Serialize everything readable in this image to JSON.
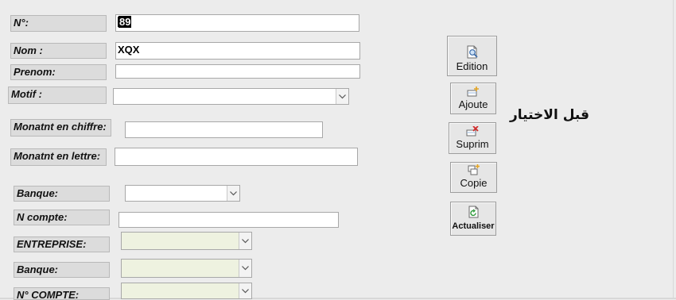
{
  "form": {
    "numero": {
      "label": "N°:",
      "value_selected": "89"
    },
    "nom": {
      "label": "Nom :",
      "value": "XQX"
    },
    "prenom": {
      "label": "Prenom:",
      "value": ""
    },
    "motif": {
      "label": "Motif :",
      "value": ""
    },
    "montant_chiffre": {
      "label": "Monatnt en chiffre:",
      "value": ""
    },
    "montant_lettre": {
      "label": "Monatnt en lettre:",
      "value": ""
    },
    "banque1": {
      "label": "Banque:",
      "value": ""
    },
    "n_compte": {
      "label": "N compte:",
      "value": ""
    },
    "entreprise": {
      "label": "ENTREPRISE:",
      "value": ""
    },
    "banque2": {
      "label": "Banque:",
      "value": ""
    },
    "n_compte2": {
      "label": "N° COMPTE:",
      "value": ""
    }
  },
  "buttons": {
    "edition": {
      "label": "Edition",
      "icon": "print-preview-icon"
    },
    "ajoute": {
      "label": "Ajoute",
      "icon": "add-record-icon"
    },
    "suprim": {
      "label": "Suprim",
      "icon": "delete-record-icon"
    },
    "copie": {
      "label": "Copie",
      "icon": "copy-record-icon"
    },
    "actualiser": {
      "label": "Actualiser",
      "icon": "refresh-icon"
    }
  },
  "annotation": {
    "text": "قبل الاختيار"
  },
  "colors": {
    "background": "#ececec",
    "label_bg": "#dcdcdc",
    "disabled_combo_bg": "#eef2e0"
  }
}
